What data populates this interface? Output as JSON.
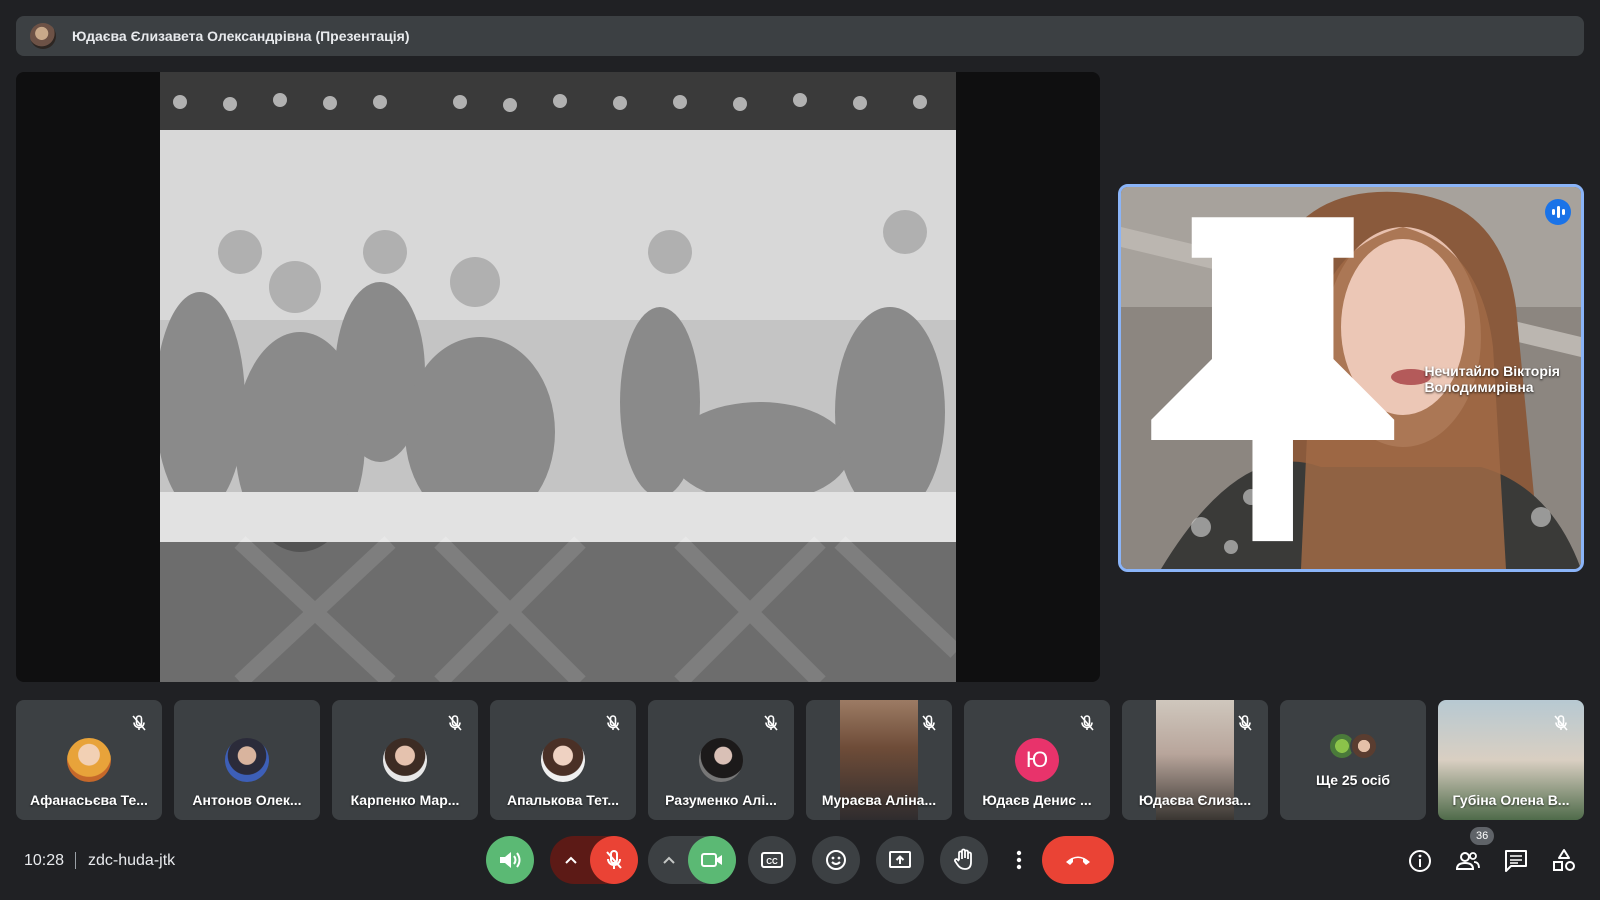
{
  "presentation": {
    "title": "Юдаєва Єлизавета Олександрівна (Презентація)"
  },
  "speaker": {
    "name": "Нечитайло Вікторія Володимирівна",
    "speaking": true,
    "pinned": true
  },
  "participants": [
    {
      "name": "Афанасьєва Те...",
      "muted": true,
      "avatar": "photo"
    },
    {
      "name": "Антонов Олек...",
      "muted": false,
      "avatar": "photo"
    },
    {
      "name": "Карпенко Мар...",
      "muted": true,
      "avatar": "photo"
    },
    {
      "name": "Апалькова Тет...",
      "muted": true,
      "avatar": "photo"
    },
    {
      "name": "Разуменко Алі...",
      "muted": true,
      "avatar": "photo"
    },
    {
      "name": "Мураєва Аліна...",
      "muted": true,
      "avatar": "video"
    },
    {
      "name": "Юдаєв Денис ...",
      "muted": true,
      "avatar": "letter",
      "letter": "Ю"
    },
    {
      "name": "Юдаєва Єлиза...",
      "muted": true,
      "avatar": "video"
    },
    {
      "name": "Ще 25 осіб",
      "muted": false,
      "avatar": "group"
    },
    {
      "name": "Губіна Олена В...",
      "muted": true,
      "avatar": "video"
    }
  ],
  "bottom_bar": {
    "time": "10:28",
    "meeting_code": "zdc-huda-jtk",
    "participants_count": "36"
  },
  "colors": {
    "background": "#202124",
    "tile": "#3c4043",
    "accent_blue": "#8ab4f8",
    "green": "#5bb974",
    "red": "#ea4335"
  }
}
